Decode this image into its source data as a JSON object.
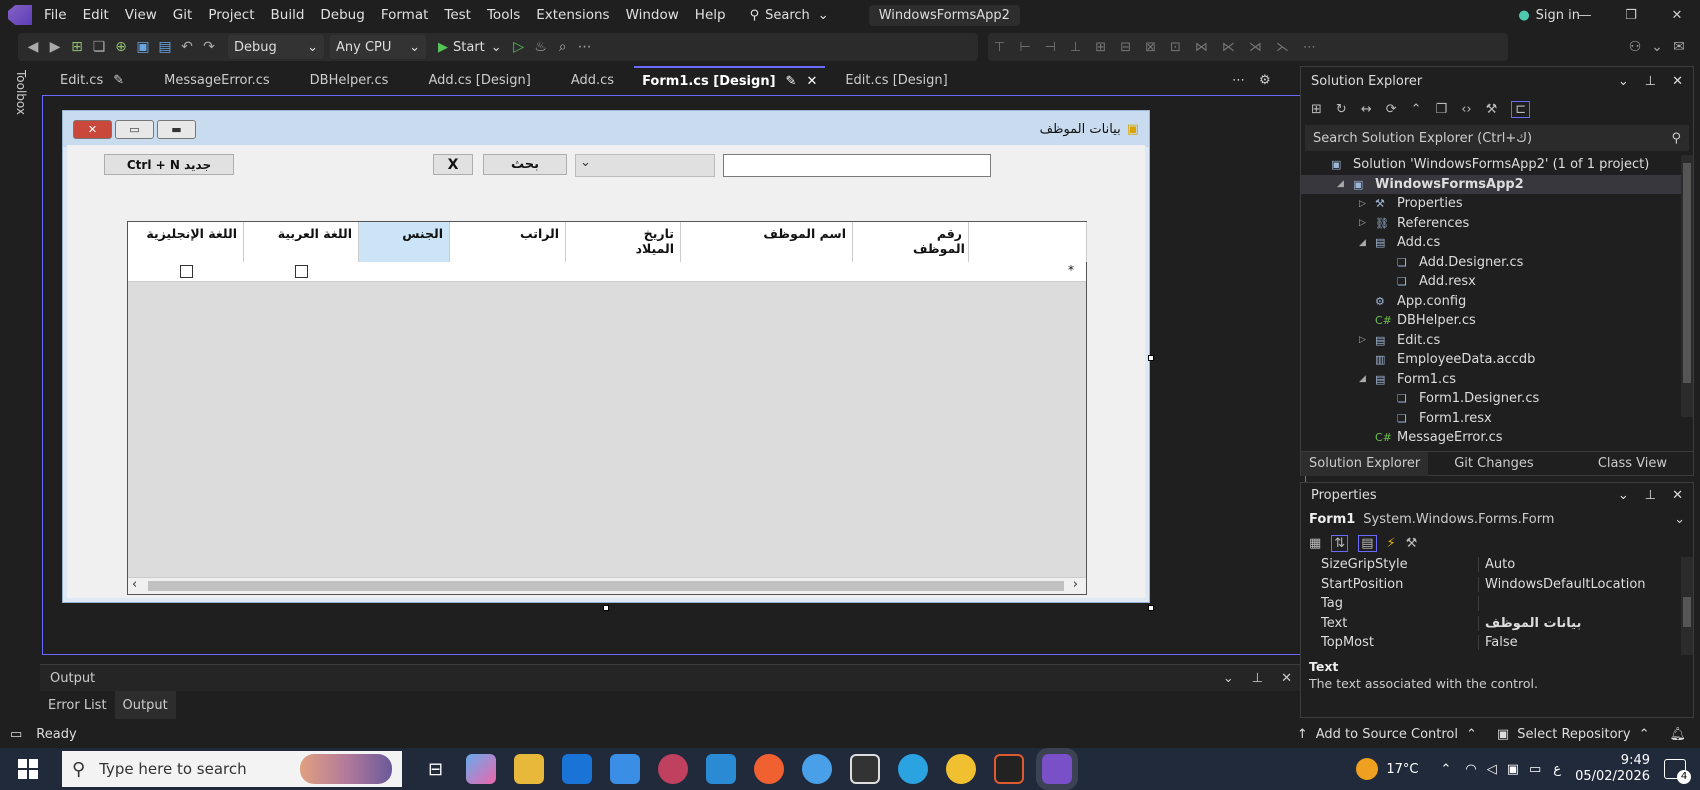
{
  "menu": [
    "File",
    "Edit",
    "View",
    "Git",
    "Project",
    "Build",
    "Debug",
    "Format",
    "Test",
    "Tools",
    "Extensions",
    "Window",
    "Help"
  ],
  "search_label": "Search",
  "solution_title": "WindowsFormsApp2",
  "sign_in": "Sign in",
  "toolbar": {
    "config": "Debug",
    "platform": "Any CPU",
    "start": "Start"
  },
  "toolbox_label": "Toolbox",
  "tabs": [
    "Edit.cs",
    "MessageError.cs",
    "DBHelper.cs",
    "Add.cs [Design]",
    "Add.cs",
    "Form1.cs [Design]",
    "Edit.cs [Design]"
  ],
  "form": {
    "title": "بيانات الموظف",
    "new_button": "Ctrl + N جديد",
    "x_button": "X",
    "search_button": "بحث",
    "columns": [
      "رقم الموظف",
      "اسم الموظف",
      "تاريخ الميلاد",
      "الراتب",
      "الجنس",
      "اللغة العربية",
      "اللغة الإنجليزية"
    ],
    "new_row_marker": "*"
  },
  "solution_explorer": {
    "title": "Solution Explorer",
    "search_placeholder": "Search Solution Explorer (Ctrl+ك)",
    "items": [
      {
        "label": "Solution 'WindowsFormsApp2' (1 of 1 project)",
        "indent": 0
      },
      {
        "label": "WindowsFormsApp2",
        "indent": 1,
        "bold": true
      },
      {
        "label": "Properties",
        "indent": 2
      },
      {
        "label": "References",
        "indent": 2
      },
      {
        "label": "Add.cs",
        "indent": 2
      },
      {
        "label": "Add.Designer.cs",
        "indent": 3
      },
      {
        "label": "Add.resx",
        "indent": 3
      },
      {
        "label": "App.config",
        "indent": 2
      },
      {
        "label": "DBHelper.cs",
        "indent": 2
      },
      {
        "label": "Edit.cs",
        "indent": 2
      },
      {
        "label": "EmployeeData.accdb",
        "indent": 2
      },
      {
        "label": "Form1.cs",
        "indent": 2
      },
      {
        "label": "Form1.Designer.cs",
        "indent": 3
      },
      {
        "label": "Form1.resx",
        "indent": 3
      },
      {
        "label": "MessageError.cs",
        "indent": 2
      }
    ],
    "bottom_tabs": [
      "Solution Explorer",
      "Git Changes",
      "Class View"
    ]
  },
  "properties": {
    "title": "Properties",
    "object": "Form1",
    "object_type": "System.Windows.Forms.Form",
    "rows": [
      {
        "name": "SizeGripStyle",
        "value": "Auto"
      },
      {
        "name": "StartPosition",
        "value": "WindowsDefaultLocation"
      },
      {
        "name": "Tag",
        "value": ""
      },
      {
        "name": "Text",
        "value": "بيانات الموظف"
      },
      {
        "name": "TopMost",
        "value": "False"
      }
    ],
    "desc_title": "Text",
    "desc_text": "The text associated with the control."
  },
  "output": {
    "title": "Output",
    "tabs": [
      "Error List",
      "Output"
    ]
  },
  "status": {
    "ready": "Ready",
    "source_control": "Add to Source Control",
    "repository": "Select Repository"
  },
  "taskbar": {
    "search_placeholder": "Type here to search",
    "temperature": "17°C",
    "time": "9:49",
    "date": "05/02/2026",
    "lang": "ع",
    "notifications": "4"
  }
}
